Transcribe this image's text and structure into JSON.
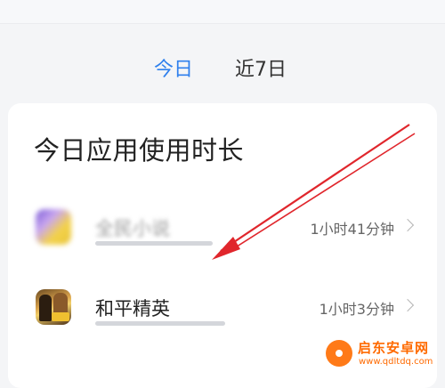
{
  "tabs": [
    {
      "label": "今日",
      "active": true
    },
    {
      "label": "近7日",
      "active": false
    }
  ],
  "card": {
    "title": "今日应用使用时长",
    "apps": [
      {
        "name": "全民小说",
        "duration": "1小时41分钟",
        "icon": "app-icon-blurred",
        "blurred": true
      },
      {
        "name": "和平精英",
        "duration": "1小时3分钟",
        "icon": "peace-elite-icon",
        "blurred": false
      }
    ]
  },
  "watermark": {
    "title": "启东安卓网",
    "url": "www.qdltdq.com"
  },
  "colors": {
    "accent": "#2f80ed",
    "annotation": "#e0262c",
    "watermark": "#ff6a00"
  }
}
